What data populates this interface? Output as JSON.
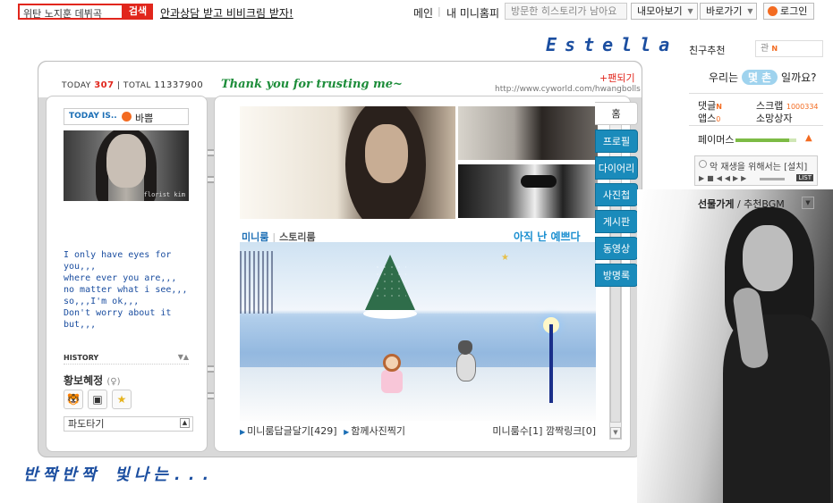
{
  "topbar": {
    "search_value": "위탄 노지훈 데뷔곡",
    "search_button": "검색",
    "promo": "안과상담 받고 비비크림 받자!",
    "nav_main": "메인",
    "nav_minihompy": "내 미니홈피",
    "visited": "방문한 히스토리가 남아요",
    "collect": "내모아보기",
    "shortcut": "바로가기",
    "login": "로그인"
  },
  "owner_name": "Estella",
  "header": {
    "today_label": "TODAY",
    "today_count": "307",
    "total_label": "TOTAL",
    "total_count": "11337900",
    "greeting": "Thank you for trusting me~",
    "fan": "팬되기",
    "url": "http://www.cyworld.com/hwangbolls"
  },
  "profile": {
    "today_is": "TODAY IS..",
    "mood": "바쁨",
    "signature": "florist kim",
    "poem": [
      "I only have eyes for",
      "you,,,",
      "where ever you are,,,",
      "no matter what i see,,,",
      "",
      "so,,,I'm ok,,,",
      "Don't worry about it",
      "but,,,"
    ],
    "history": "HISTORY",
    "owner": "황보혜정",
    "sex": "(♀)",
    "wave": "파도타기"
  },
  "miniroom": {
    "tab_miniroom": "미니룸",
    "tab_story": "스토리룸",
    "title": "아직 난 예쁘다",
    "footer_link1": "미니룸답글달기[429]",
    "footer_link2": "함께사진찍기",
    "footer_count": "미니룸수[1]",
    "footer_link3": "깜짝링크[0]"
  },
  "side_tabs": [
    "홈",
    "프로필",
    "다이어리",
    "사진첩",
    "게시판",
    "동영상",
    "방명록"
  ],
  "bottom_text": "반짝반짝 빛나는...",
  "sidebar": {
    "friend_rec": "친구추천",
    "friend_box": "관",
    "relation_pre": "우리는",
    "relation_badge": "몇 촌",
    "relation_post": "일까요?",
    "comments": "댓글",
    "scrap": "스크랩",
    "scrap_count": "1000334",
    "apps": "앱스",
    "apps_count": "0",
    "shop": "소망상자",
    "pm": "페이머스",
    "player_msg": "악 재생을 위해서는 [설치]",
    "list": "LIST",
    "bgm_bold": "선물가게",
    "bgm_rest": " / 추천BGM"
  }
}
